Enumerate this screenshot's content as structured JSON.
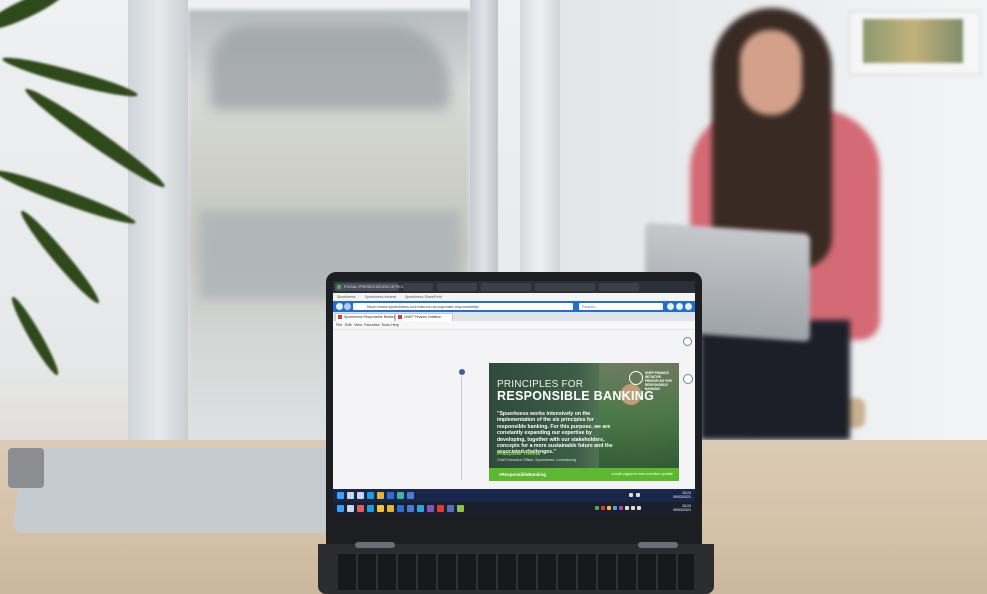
{
  "browser": {
    "active_tab_title": "PUGAL PRESENTATION OFFICE 365 SITE",
    "tabs": [
      "",
      "",
      "",
      "",
      ""
    ],
    "bookmarks": [
      "Spuerkeess",
      "Spuerkeess Intranet",
      "Spuerkeess SharePoint"
    ],
    "url": "https://www.spuerkeess.lu/en/about-us/corporate-responsibility/",
    "search_placeholder": "Search...",
    "page_tabs": [
      "Spuerkeess Responsible Banking",
      "UNEP Finance Initiative"
    ],
    "menu": [
      "File",
      "Edit",
      "View",
      "Favorites",
      "Tools",
      "Help"
    ]
  },
  "banner": {
    "title_line1": "PRINCIPLES FOR",
    "title_line2": "RESPONSIBLE BANKING",
    "logo_text": "UNEP FINANCE INITIATIVE PRINCIPLES FOR RESPONSIBLE BANKING",
    "quote": "\"Spuerkeess works intensively on the implementation of the six principles for responsible banking. For this purpose, we are constantly expanding our expertise by developing, together with our stakeholders, concepts for a more sustainable future and the associated challenges.\"",
    "person_name": "Françoise Thoma",
    "person_role": "Chief Executive Officer, Spuerkeess, Luxembourg",
    "hashtag": "#ResponsibleBanking",
    "link": "unepfi.org/pmb-new-member-update"
  },
  "taskbar": {
    "time_top": "15:24",
    "date_top": "09/03/2021",
    "time_bottom": "15:24",
    "date_bottom": "09/03/2021"
  },
  "colors": {
    "banner_green": "#5cb82e",
    "browser_blue": "#1f6fd4",
    "taskbar": "#17264a"
  }
}
